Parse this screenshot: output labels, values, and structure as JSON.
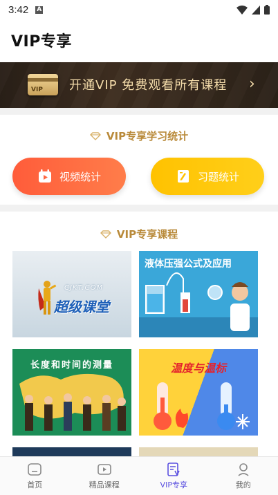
{
  "status_bar": {
    "time": "3:42",
    "notification_icon": "A"
  },
  "header": {
    "title": "VIP专享"
  },
  "banner": {
    "card_label": "VIP",
    "text": "开通VIP 免费观看所有课程",
    "chevron": "›"
  },
  "stats": {
    "title": "VIP专享学习统计",
    "video_label": "视频统计",
    "exercise_label": "习题统计"
  },
  "courses": {
    "title": "VIP专享课程",
    "items": [
      {
        "logo_text": "超级课堂",
        "url_text": "CJKT.COM"
      },
      {
        "title": "液体压强公式及应用"
      },
      {
        "title": "长度和时间的测量"
      },
      {
        "title": "温度与温标"
      }
    ]
  },
  "tabbar": {
    "items": [
      {
        "label": "首页",
        "icon": "home-icon"
      },
      {
        "label": "精品课程",
        "icon": "video-icon"
      },
      {
        "label": "VIP专享",
        "icon": "vip-doc-icon",
        "active": true
      },
      {
        "label": "我的",
        "icon": "profile-icon"
      }
    ]
  },
  "colors": {
    "accent": "#5b50e0",
    "video_btn": "#ff5c3a",
    "exercise_btn": "#ffc200",
    "gold": "#b98a3a"
  }
}
